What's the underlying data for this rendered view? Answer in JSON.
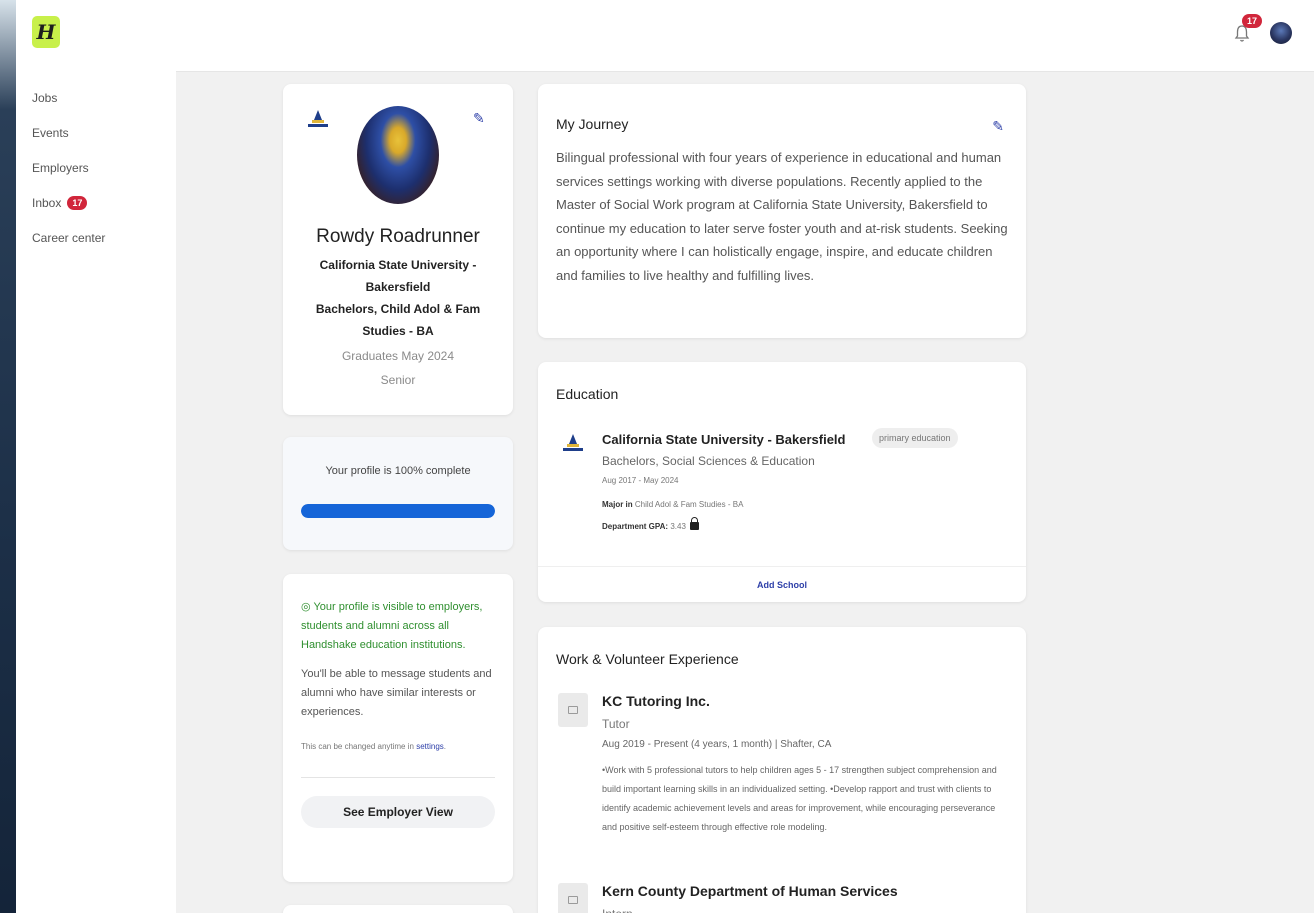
{
  "brand": {
    "logo_letter": "H"
  },
  "nav": {
    "items": [
      "Jobs",
      "Events",
      "Employers",
      "Inbox",
      "Career center"
    ],
    "inbox_badge": "17"
  },
  "topbar": {
    "notification_count": "17"
  },
  "profile": {
    "name": "Rowdy Roadrunner",
    "school": "California State University - Bakersfield",
    "degree": "Bachelors, Child Adol & Fam Studies - BA",
    "graduation": "Graduates May 2024",
    "class_level": "Senior"
  },
  "progress": {
    "text": "Your profile is 100% complete",
    "percent": 100
  },
  "visibility": {
    "status": "Your profile is visible to employers, students and alumni across all Handshake education institutions.",
    "body": "You'll be able to message students and alumni who have similar interests or experiences.",
    "note": "This can be changed anytime in",
    "settings_link": "settings",
    "button": "See Employer View"
  },
  "journey": {
    "title": "My Journey",
    "text": "Bilingual professional with four years of experience in educational and human services settings working with diverse populations. Recently applied to the Master of Social Work program at California State University, Bakersfield to continue my education to later serve foster youth and at-risk students. Seeking an opportunity where I can holistically engage, inspire, and educate children and families to live healthy and fulfilling lives."
  },
  "education": {
    "title": "Education",
    "school": "California State University - Bakersfield",
    "tag": "primary education",
    "degree": "Bachelors, Social Sciences & Education",
    "dates": "Aug 2017 - May 2024",
    "major_label": "Major in",
    "major": "Child Adol & Fam Studies - BA",
    "gpa_label": "Department GPA:",
    "gpa": "3.43",
    "add_school": "Add School"
  },
  "work": {
    "title": "Work & Volunteer Experience",
    "jobs": [
      {
        "employer": "KC Tutoring Inc.",
        "role": "Tutor",
        "meta": "Aug 2019 - Present (4 years, 1 month) | Shafter, CA",
        "desc": "•Work with 5 professional tutors to help children ages 5 - 17 strengthen subject comprehension and build important learning skills in an individualized setting. •Develop rapport and trust with clients to identify academic achievement levels and areas for improvement, while encouraging perseverance and positive self-esteem through effective role modeling."
      },
      {
        "employer": "Kern County Department of Human Services",
        "role": "Intern"
      }
    ]
  },
  "colors": {
    "accent": "#1565d8",
    "brand": "#c8f04a",
    "badge": "#d1263b",
    "link": "#2d3fa8"
  }
}
